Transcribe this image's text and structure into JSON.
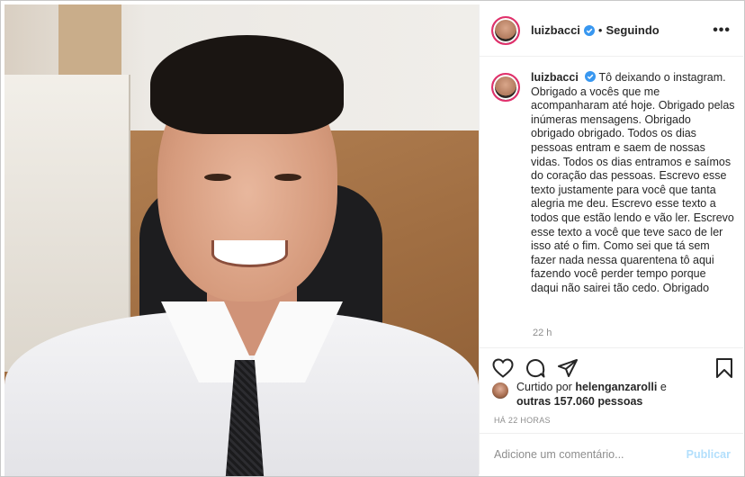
{
  "post": {
    "username": "luizbacci",
    "separator": "•",
    "follow_status": "Seguindo",
    "more_glyph": "•••"
  },
  "caption": {
    "username": "luizbacci",
    "text": "Tô deixando o instagram. Obrigado a vocês que me acompanharam até hoje. Obrigado pelas inúmeras mensagens. Obrigado obrigado obrigado. Todos os dias pessoas entram e saem de nossas vidas. Todos os dias entramos e saímos do coração das pessoas. Escrevo esse texto justamente para você que tanta alegria me deu. Escrevo esse texto a todos que estão lendo e vão ler. Escrevo esse texto a você que teve saco de ler isso até o fim. Como sei que tá sem fazer nada nessa quarentena tô aqui fazendo você perder tempo porque daqui não sairei tão cedo. Obrigado",
    "age": "22 h"
  },
  "likes": {
    "prefix": "Curtido por",
    "liker": "helenganzarolli",
    "conjunction": "e",
    "others": "outras 157.060 pessoas"
  },
  "timestamp": "HÁ 22 HORAS",
  "comment": {
    "placeholder": "Adicione um comentário...",
    "publish_label": "Publicar"
  },
  "colors": {
    "verified": "#3897f0",
    "story_ring": "#e1306c",
    "publish_disabled": "#b2dffc",
    "muted_text": "#8e8e8e"
  },
  "icons": [
    "heart-icon",
    "comment-icon",
    "share-icon",
    "bookmark-icon",
    "verified-icon",
    "more-icon"
  ]
}
